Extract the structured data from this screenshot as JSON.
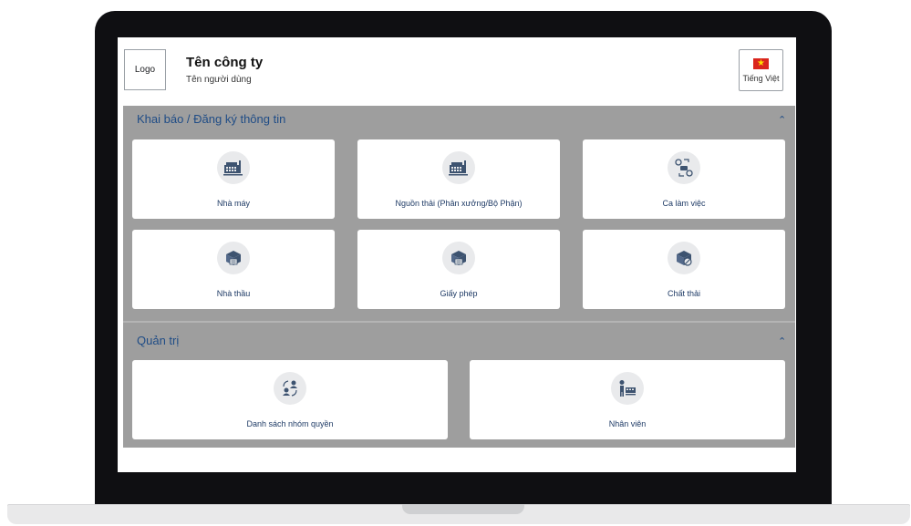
{
  "header": {
    "logo_label": "Logo",
    "company_name": "Tên công ty",
    "user_name": "Tên người dùng",
    "language": {
      "label": "Tiếng Việt",
      "flag_star": "★"
    }
  },
  "sections": [
    {
      "title": "Khai báo / Đăng ký thông tin",
      "chevron": "⌃",
      "cards": [
        {
          "label": "Nhà máy",
          "icon": "factory-icon"
        },
        {
          "label": "Nguồn thải (Phân xưởng/Bộ Phận)",
          "icon": "factory-icon"
        },
        {
          "label": "Ca làm việc",
          "icon": "shift-schedule-icon"
        },
        {
          "label": "Nhà thầu",
          "icon": "contractor-box-icon"
        },
        {
          "label": "Giấy phép",
          "icon": "permit-box-icon"
        },
        {
          "label": "Chất thải",
          "icon": "waste-icon"
        }
      ]
    },
    {
      "title": "Quản trị",
      "chevron": "⌃",
      "cards": [
        {
          "label": "Danh sách nhóm quyền",
          "icon": "user-groups-icon"
        },
        {
          "label": "Nhân viên",
          "icon": "employee-icon"
        }
      ]
    }
  ],
  "colors": {
    "accent": "#1f4c86",
    "panel_bg": "#9e9e9e",
    "icon_dark": "#3d5370",
    "flag_red": "#da251d",
    "flag_yellow": "#ffde00"
  }
}
